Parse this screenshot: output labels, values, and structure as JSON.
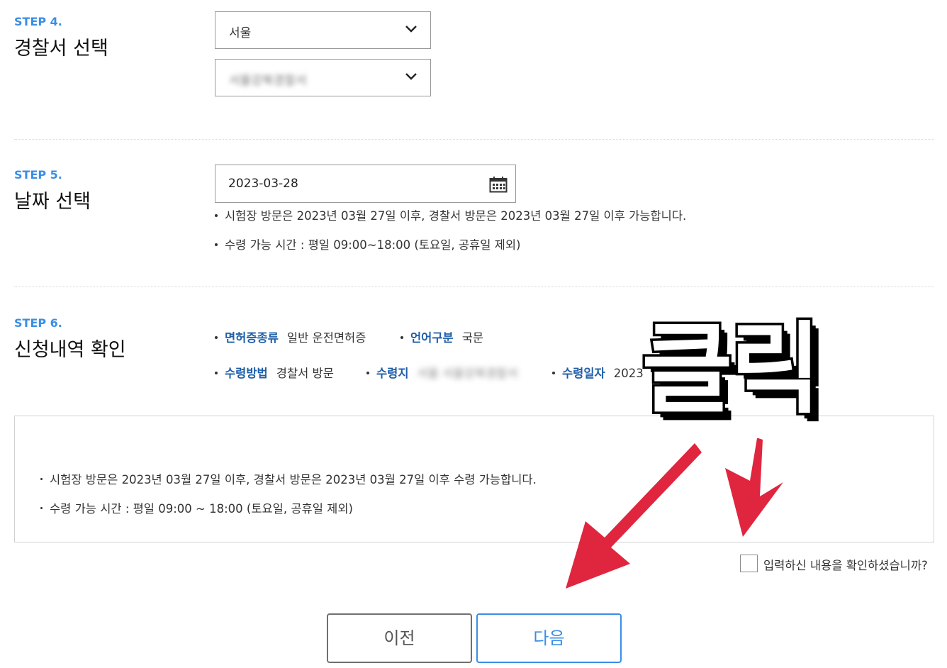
{
  "step4": {
    "label": "STEP 4.",
    "title": "경찰서 선택",
    "region_select": "서울",
    "station_select": "서울강북경찰서"
  },
  "step5": {
    "label": "STEP 5.",
    "title": "날짜 선택",
    "date_value": "2023-03-28",
    "note1": "시험장 방문은 2023년 03월 27일 이후, 경찰서 방문은 2023년 03월 27일 이후 가능합니다.",
    "note2": "수령 가능 시간 : 평일 09:00~18:00 (토요일, 공휴일 제외)"
  },
  "step6": {
    "label": "STEP 6.",
    "title": "신청내역 확인",
    "license_type_label": "면허증종류",
    "license_type_value": "일반 운전면허증",
    "language_label": "언어구분",
    "language_value": "국문",
    "method_label": "수령방법",
    "method_value": "경찰서 방문",
    "place_label": "수령지",
    "place_value": "서울 서울강북경찰서",
    "date_label": "수령일자",
    "date_value": "2023"
  },
  "notice": {
    "line1": "시험장 방문은 2023년 03월 27일 이후, 경찰서 방문은 2023년 03월 27일 이후 수령 가능합니다.",
    "line2": "수령 가능 시간 : 평일 09:00 ~ 18:00 (토요일, 공휴일 제외)"
  },
  "confirm_label": "입력하신 내용을 확인하셨습니까?",
  "buttons": {
    "prev": "이전",
    "next": "다음"
  },
  "overlay": {
    "text": "클릭"
  },
  "colors": {
    "accent": "#3a8ee6",
    "key_text": "#1f5fa8",
    "arrow": "#e0253f"
  }
}
